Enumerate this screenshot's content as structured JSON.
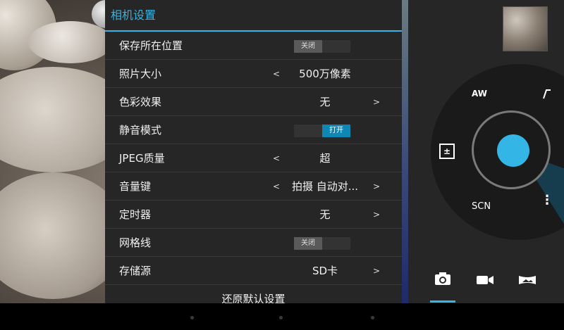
{
  "settings": {
    "title": "相机设置",
    "rows": [
      {
        "label": "保存所在位置",
        "toggle": "关闭"
      },
      {
        "label": "照片大小",
        "value": "500万像素",
        "left": "<"
      },
      {
        "label": "色彩效果",
        "value": "无",
        "right": ">"
      },
      {
        "label": "静音模式",
        "toggle": "打开"
      },
      {
        "label": "JPEG质量",
        "value": "超",
        "left": "<"
      },
      {
        "label": "音量键",
        "value": "拍摄 自动对...",
        "left": "<",
        "right": ">"
      },
      {
        "label": "定时器",
        "value": "无",
        "right": ">"
      },
      {
        "label": "网格线",
        "toggle": "关闭"
      },
      {
        "label": "存储源",
        "value": "SD卡",
        "right": ">"
      }
    ],
    "reset_label": "还原默认设置"
  },
  "controls": {
    "auto_white_balance": "AW",
    "scn_label": "SCN",
    "more_label": "⋮",
    "exposure_label": "±"
  },
  "colors": {
    "accent": "#33b5e5",
    "panel": "#262626"
  },
  "icons": [
    "camera-icon",
    "video-icon",
    "panorama-icon",
    "shutter-icon",
    "flash-icon",
    "exposure-icon",
    "more-icon"
  ]
}
